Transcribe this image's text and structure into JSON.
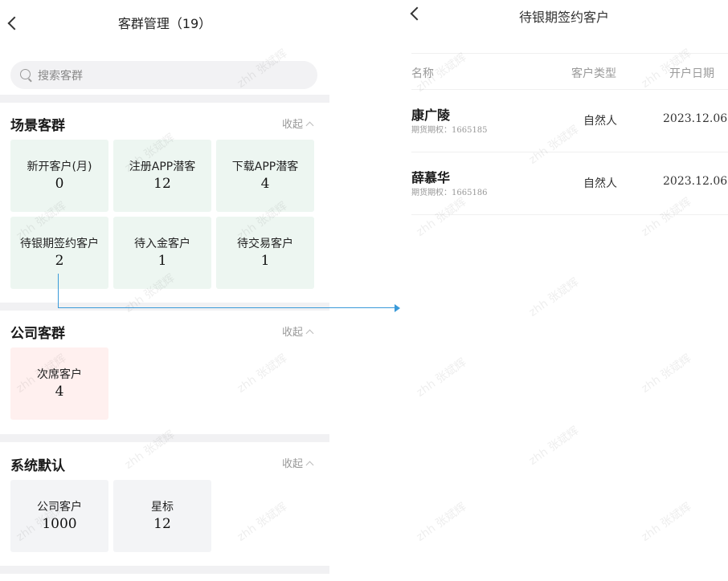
{
  "left": {
    "title": "客群管理（19）",
    "search_placeholder": "搜索客群",
    "sections": [
      {
        "title": "场景客群",
        "collapse_label": "收起",
        "cards": [
          {
            "label": "新开客户(月)",
            "count": "0"
          },
          {
            "label": "注册APP潜客",
            "count": "12"
          },
          {
            "label": "下载APP潜客",
            "count": "4"
          },
          {
            "label": "待银期签约客户",
            "count": "2"
          },
          {
            "label": "待入金客户",
            "count": "1"
          },
          {
            "label": "待交易客户",
            "count": "1"
          }
        ]
      },
      {
        "title": "公司客群",
        "collapse_label": "收起",
        "cards": [
          {
            "label": "次席客户",
            "count": "4"
          }
        ]
      },
      {
        "title": "系统默认",
        "collapse_label": "收起",
        "cards": [
          {
            "label": "公司客户",
            "count": "1000"
          },
          {
            "label": "星标",
            "count": "12"
          }
        ]
      }
    ]
  },
  "right": {
    "title": "待银期签约客户",
    "columns": {
      "name": "名称",
      "type": "客户类型",
      "date": "开户日期"
    },
    "rows": [
      {
        "name": "康广陵",
        "account": "期货期权：1665185",
        "type": "自然人",
        "date": "2023.12.06"
      },
      {
        "name": "薛慕华",
        "account": "期货期权：1665186",
        "type": "自然人",
        "date": "2023.12.06"
      }
    ]
  },
  "watermark": "zhh 张斌辉",
  "colors": {
    "scene_card_bg": "#edf6f1",
    "company_card_bg": "#fff0ef",
    "default_card_bg": "#f3f4f6",
    "connector": "#3a9ad9",
    "section_gap": "#f1f1f3"
  }
}
